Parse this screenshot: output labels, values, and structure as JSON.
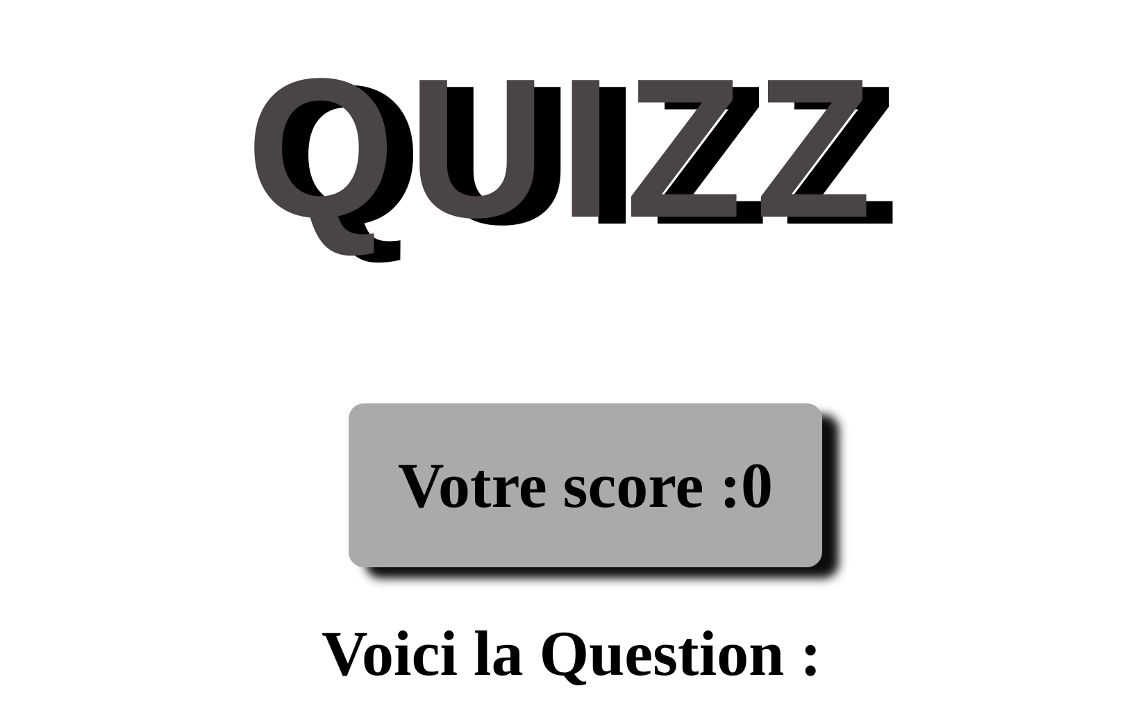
{
  "header": {
    "title": "QUIZZ"
  },
  "score": {
    "label": "Votre score :",
    "value": "0"
  },
  "question": {
    "label": "Voici la Question :"
  },
  "colors": {
    "background": "#ffffff",
    "title_main": "#4a4444",
    "title_shadow": "#000000",
    "score_box": "#aaaaaa",
    "text": "#000000"
  }
}
